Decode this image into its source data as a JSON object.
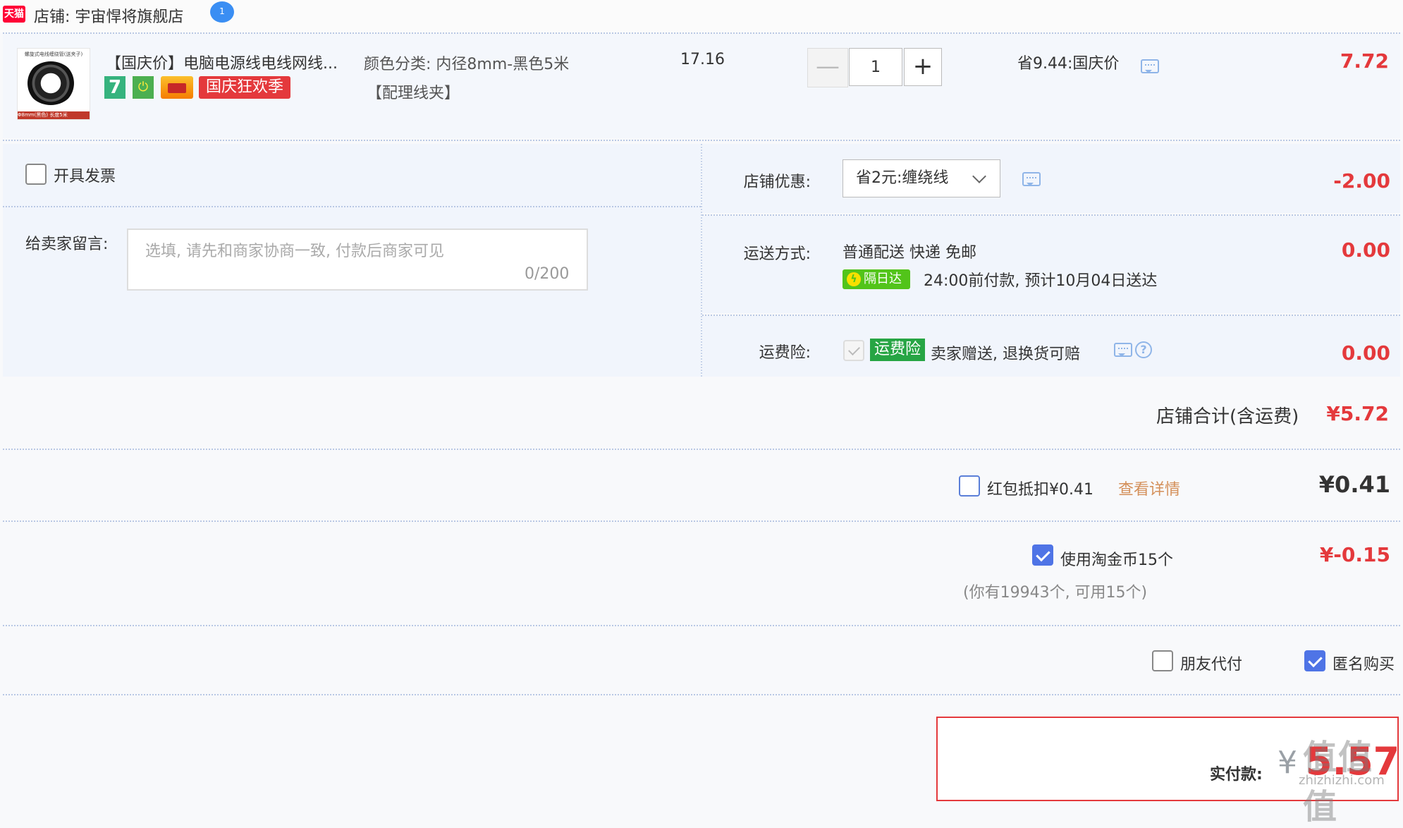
{
  "store": {
    "platform_badge": "天猫",
    "name": "店铺: 宇宙悍将旗舰店",
    "chat_icon_text": "1"
  },
  "item": {
    "thumb_caption": "螺旋式电线缠绕管(送夹子)",
    "thumb_footer": "Φ8mm(黑色)   长度5米",
    "title": "【国庆价】电脑电源线电线网线...",
    "badge_seven": "7",
    "badge_promo": "国庆狂欢季",
    "sku_line1": "颜色分类: 内径8mm-黑色5米",
    "sku_line2": "【配理线夹】",
    "unit_price": "17.16",
    "qty_minus": "—",
    "quantity": "1",
    "qty_plus": "+",
    "promo": "省9.44:国庆价",
    "total": "7.72"
  },
  "invoice": {
    "label": "开具发票"
  },
  "message": {
    "label": "给卖家留言:",
    "placeholder": "选填, 请先和商家协商一致, 付款后商家可见",
    "counter": "0/200"
  },
  "store_discount": {
    "label": "店铺优惠:",
    "selected": "省2元:缠绕线",
    "amount": "-2.00"
  },
  "shipping": {
    "label": "运送方式:",
    "method": "普通配送 快递 免邮",
    "fast_badge": "隔日达",
    "eta": "24:00前付款, 预计10月04日送达",
    "amount": "0.00"
  },
  "insurance": {
    "label": "运费险:",
    "tag": "运费险",
    "text": "卖家赠送, 退换货可赔",
    "amount": "0.00"
  },
  "store_total": {
    "label": "店铺合计(含运费)",
    "value": "¥5.72"
  },
  "red_packet": {
    "label": "红包抵扣¥0.41",
    "link": "查看详情",
    "amount": "¥0.41"
  },
  "coins": {
    "label": "使用淘金币15个",
    "hint": "(你有19943个, 可用15个)",
    "amount": "¥-0.15"
  },
  "options": {
    "friend_pay": "朋友代付",
    "anonymous": "匿名购买"
  },
  "pay": {
    "label": "实付款:",
    "yen": "¥",
    "amount": "5.57",
    "watermark": "值值值",
    "watermark_sub": "zhizhizhi.com"
  },
  "colors": {
    "accent_red": "#e4393c",
    "checkbox_blue": "#4f74e6",
    "insurance_green": "#27a544",
    "fast_green": "#52c41a",
    "link_orange": "#d4905a"
  },
  "icons": [
    "tmall-logo-icon",
    "chat-icon",
    "message-bubble-icon",
    "chevron-down-icon",
    "question-icon",
    "checkbox-icon",
    "lightning-icon"
  ]
}
